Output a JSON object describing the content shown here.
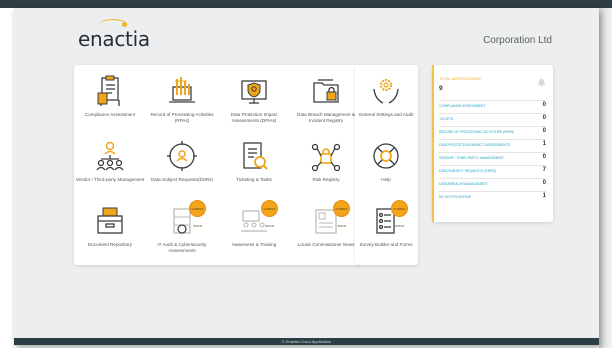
{
  "header": {
    "logo_text": "enactia",
    "company": "Corporation Ltd"
  },
  "tiles": [
    {
      "label": "Compliance Assessment",
      "icon": "clipboard-check-icon"
    },
    {
      "label": "Record of Processing Activities (RPAs)",
      "icon": "laptop-chart-icon"
    },
    {
      "label": "Data Protection Impact Assessments (DPIAs)",
      "icon": "monitor-shield-icon"
    },
    {
      "label": "Data Breach Management & Incident Registry",
      "icon": "folder-lock-icon"
    },
    {
      "label": "Vendor / Third-party Management",
      "icon": "org-chart-icon"
    },
    {
      "label": "Data Subject Requests(DSRs)",
      "icon": "person-target-icon"
    },
    {
      "label": "Ticketing & Tasks",
      "icon": "checklist-magnifier-icon"
    },
    {
      "label": "Risk Registry",
      "icon": "lock-network-icon"
    },
    {
      "label": "Document Repository",
      "icon": "archive-box-icon"
    },
    {
      "label": "IT Audit & Cybersecurity Assessments",
      "icon": "server-lock-icon",
      "badge": "COMING SOON"
    },
    {
      "label": "Awareness & Training",
      "icon": "classroom-icon",
      "badge": "COMING SOON"
    },
    {
      "label": "Locale Commissioner News",
      "icon": "newspaper-icon",
      "badge": "COMING SOON"
    }
  ],
  "side_tiles": [
    {
      "label": "General Settings and Audit",
      "icon": "gear-hands-icon"
    },
    {
      "label": "Help",
      "icon": "lifebuoy-icon"
    },
    {
      "label": "Survey Builder and Forms",
      "icon": "survey-form-icon",
      "badge": "COMING SOON"
    }
  ],
  "stats": {
    "heading": "TOTAL NOTIFICATIONS",
    "total": "9",
    "rows": [
      {
        "name": "COMPLIANCE ASSESSMENT",
        "value": "0"
      },
      {
        "name": "TICKETS",
        "value": "0"
      },
      {
        "name": "RECORD OF PROCESSING ACTIVITIES (RPAS)",
        "value": "0"
      },
      {
        "name": "DATA PROTECTION IMPACT ASSESSMENTS",
        "value": "1"
      },
      {
        "name": "VENDOR / THIRD-PARTY MANAGEMENT",
        "value": "0"
      },
      {
        "name": "DATA SUBJECT REQUESTS (DSRS)",
        "value": "7"
      },
      {
        "name": "DATA BREACH MANAGEMENT",
        "value": "0"
      },
      {
        "name": "MY NOTIFICATIONS",
        "value": "1"
      }
    ]
  },
  "footer": {
    "text": "© Enactia Cloud Application"
  },
  "colors": {
    "accent": "#f2a51a",
    "link": "#1da1c4",
    "footer": "#2b3f44"
  }
}
